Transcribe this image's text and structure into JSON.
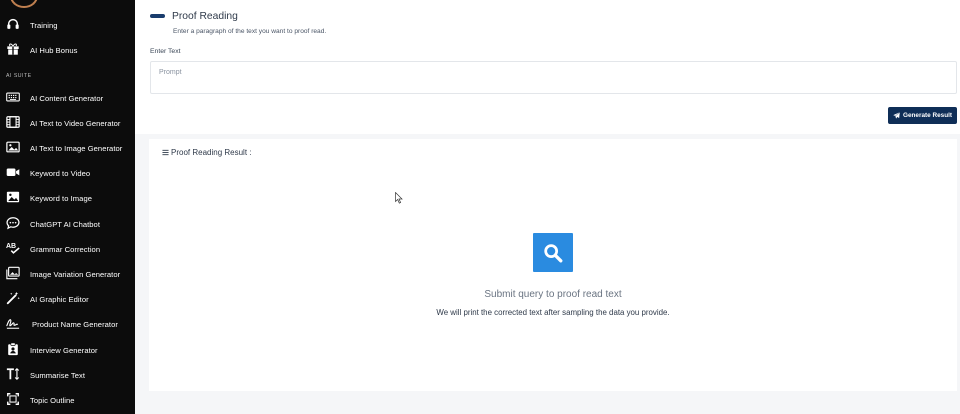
{
  "sidebar": {
    "section_label": "AI SUITE",
    "items": [
      {
        "label": "Training",
        "icon": "headset-icon"
      },
      {
        "label": "AI Hub Bonus",
        "icon": "gift-icon"
      },
      {
        "label": "AI Content Generator",
        "icon": "keyboard-icon"
      },
      {
        "label": "AI Text to Video Generator",
        "icon": "film-icon"
      },
      {
        "label": "AI Text to Image Generator",
        "icon": "image-icon"
      },
      {
        "label": "Keyword to Video",
        "icon": "video-camera-icon"
      },
      {
        "label": "Keyword to Image",
        "icon": "picture-icon"
      },
      {
        "label": "ChatGPT AI Chatbot",
        "icon": "chat-bubble-icon"
      },
      {
        "label": "Grammar Correction",
        "icon": "spellcheck-icon"
      },
      {
        "label": "Image Variation Generator",
        "icon": "images-icon"
      },
      {
        "label": "AI Graphic Editor",
        "icon": "magic-wand-icon"
      },
      {
        "label": "Product Name Generator",
        "icon": "signature-icon"
      },
      {
        "label": "Interview Generator",
        "icon": "clipboard-user-icon"
      },
      {
        "label": "Summarise Text",
        "icon": "text-height-icon"
      },
      {
        "label": "Topic Outline",
        "icon": "outline-square-icon"
      }
    ]
  },
  "page": {
    "title": "Proof Reading",
    "subtitle": "Enter a paragraph of the text you want to proof read.",
    "field_label": "Enter Text",
    "prompt_placeholder": "Prompt",
    "prompt_value": "",
    "generate_label": "Generate Result"
  },
  "result": {
    "heading": "Proof Reading Result :",
    "empty_title": "Submit query to proof read text",
    "empty_desc": "We will print the corrected text after sampling the data you provide."
  },
  "colors": {
    "sidebar_bg": "#0c0c0c",
    "accent_navy": "#0f2e57",
    "search_blue": "#2a8be0"
  }
}
